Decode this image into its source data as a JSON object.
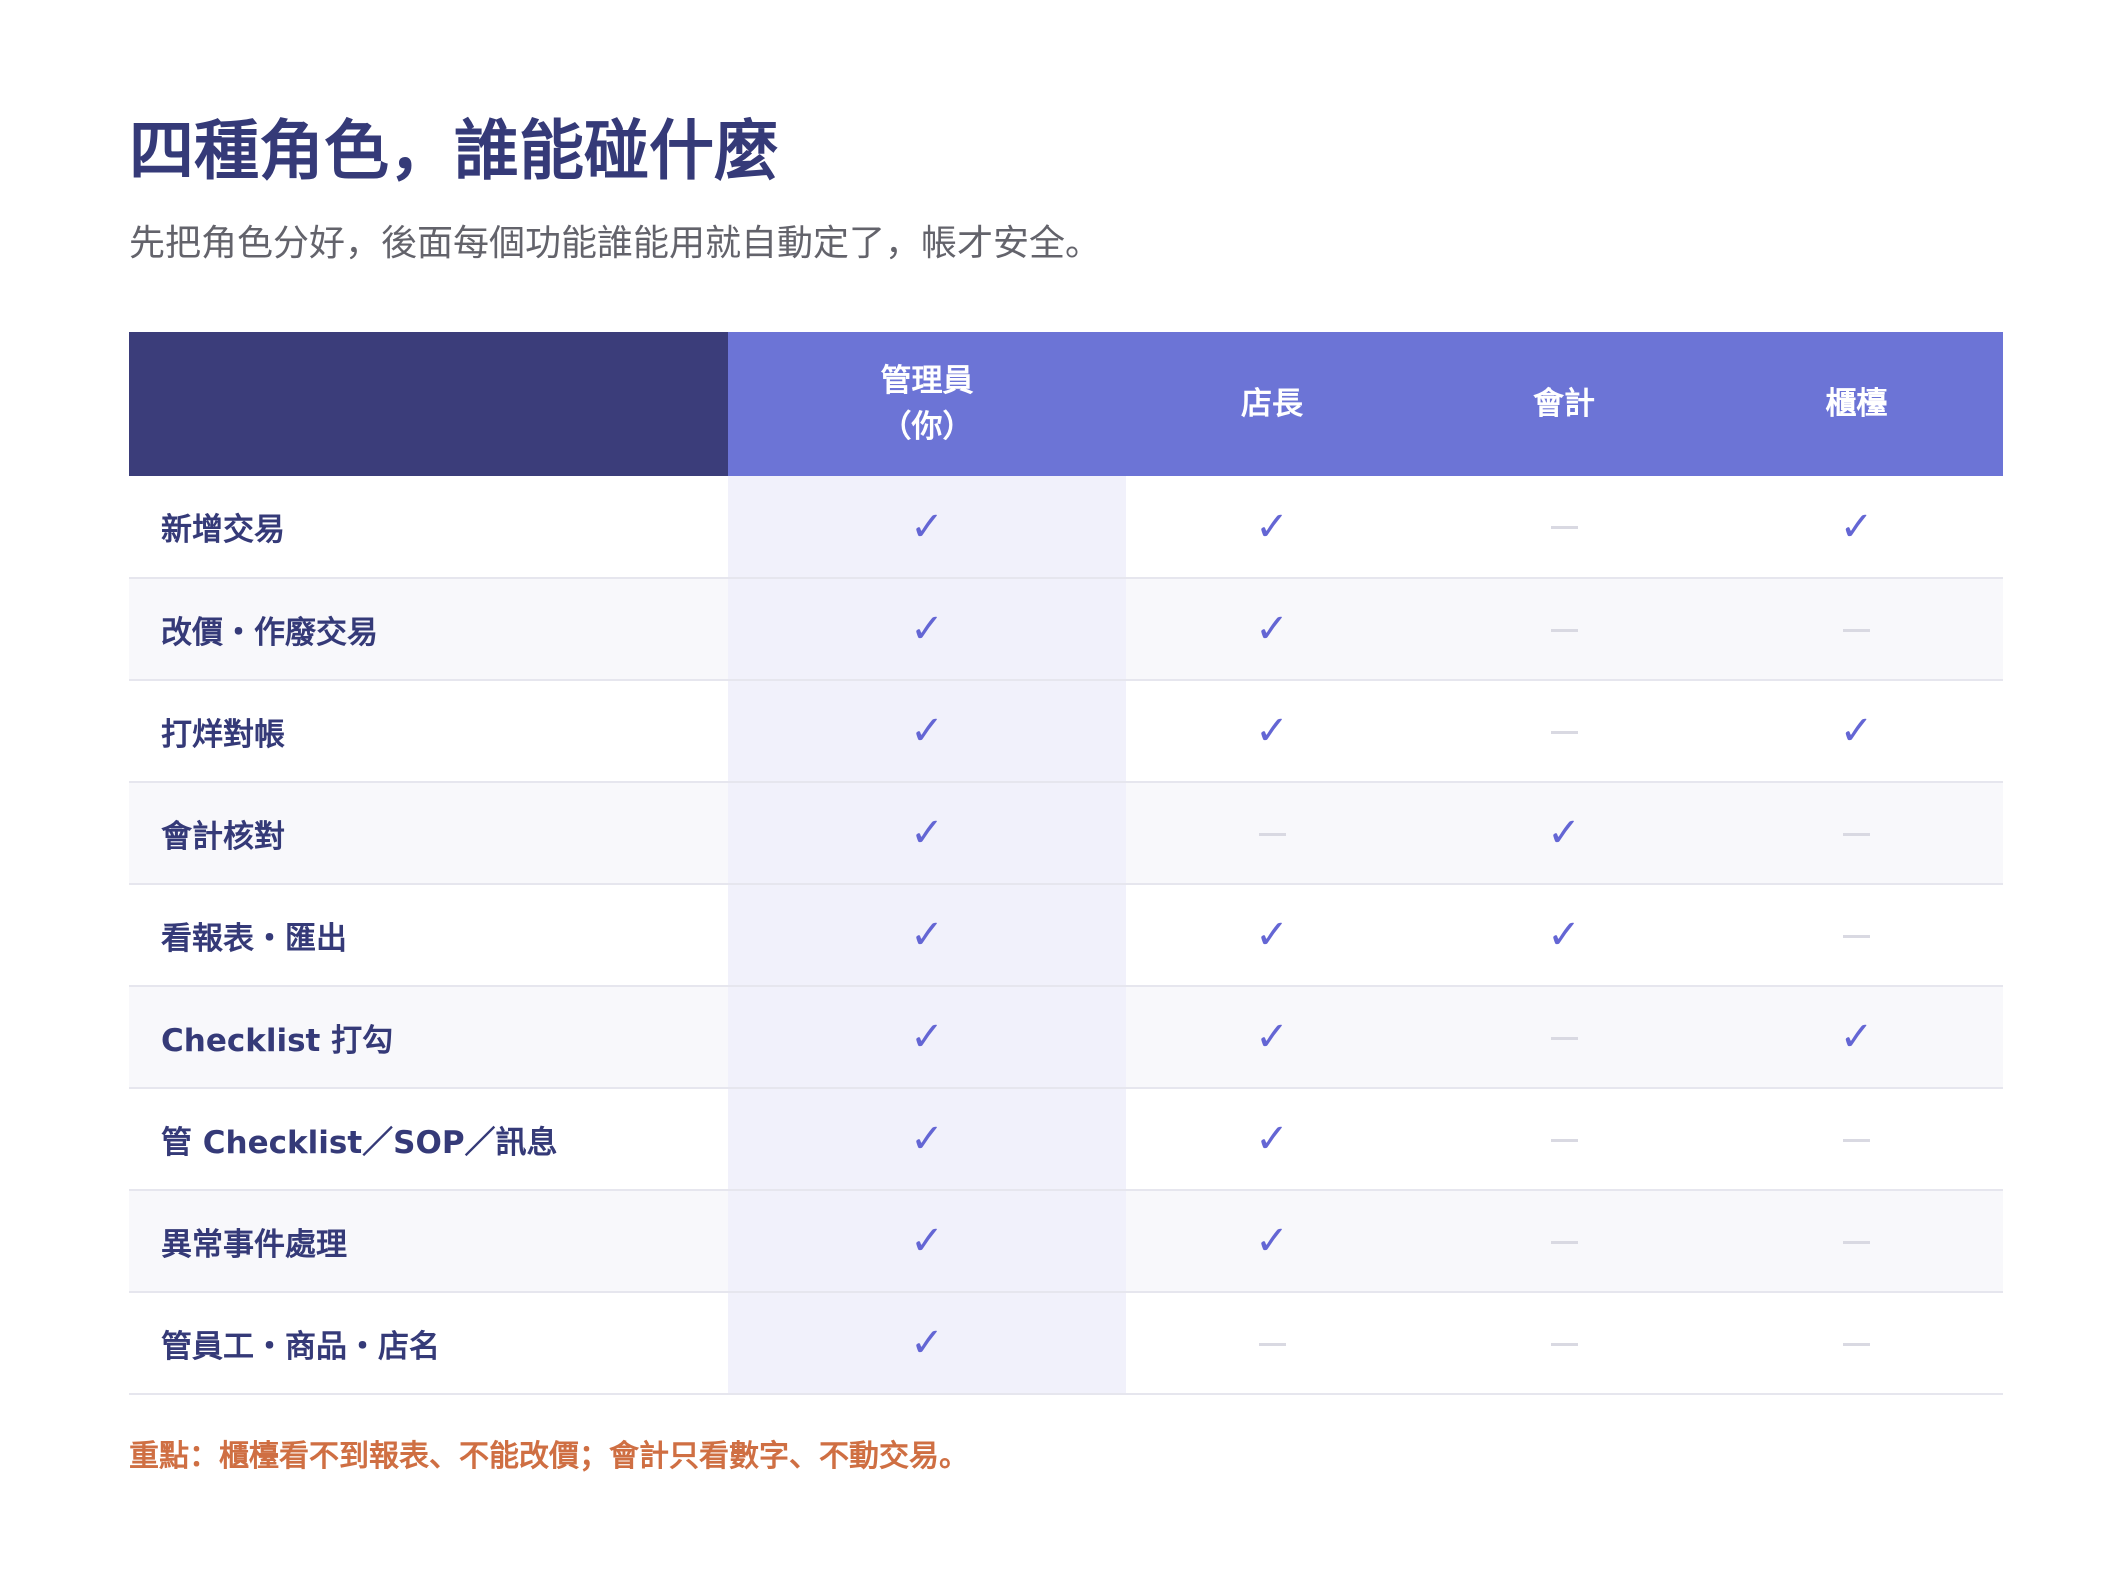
{
  "header": {
    "title": "四種角色，誰能碰什麼",
    "subtitle": "先把角色分好，後面每個功能誰能用就自動定了，帳才安全。"
  },
  "matrix": {
    "columns": [
      {
        "key": "admin",
        "label_lines": [
          "管理員",
          "（你）"
        ]
      },
      {
        "key": "manager",
        "label_lines": [
          "店長"
        ]
      },
      {
        "key": "accountant",
        "label_lines": [
          "會計"
        ]
      },
      {
        "key": "cashier",
        "label_lines": [
          "櫃檯"
        ]
      }
    ],
    "symbols": {
      "allowed": "✓",
      "allowed_name": "check-icon",
      "denied_name": "dash-icon"
    },
    "rows": [
      {
        "feature": "新增交易",
        "access": [
          true,
          true,
          false,
          true
        ]
      },
      {
        "feature": "改價・作廢交易",
        "access": [
          true,
          true,
          false,
          false
        ]
      },
      {
        "feature": "打烊對帳",
        "access": [
          true,
          true,
          false,
          true
        ]
      },
      {
        "feature": "會計核對",
        "access": [
          true,
          false,
          true,
          false
        ]
      },
      {
        "feature": "看報表・匯出",
        "access": [
          true,
          true,
          true,
          false
        ]
      },
      {
        "feature": "Checklist 打勾",
        "access": [
          true,
          true,
          false,
          true
        ]
      },
      {
        "feature": "管 Checklist／SOP／訊息",
        "access": [
          true,
          true,
          false,
          false
        ]
      },
      {
        "feature": "異常事件處理",
        "access": [
          true,
          true,
          false,
          false
        ]
      },
      {
        "feature": "管員工・商品・店名",
        "access": [
          true,
          false,
          false,
          false
        ]
      }
    ]
  },
  "footer": {
    "note": "重點：櫃檯看不到報表、不能改價；會計只看數字、不動交易。"
  },
  "colors": {
    "title": "#353a78",
    "header_corner": "#3b3d7a",
    "header_roles": "#6c74d6",
    "check": "#6466d4",
    "dash": "#d9d9e2",
    "admin_column_tint": "#f1f1fb",
    "note": "#cf6f43"
  }
}
